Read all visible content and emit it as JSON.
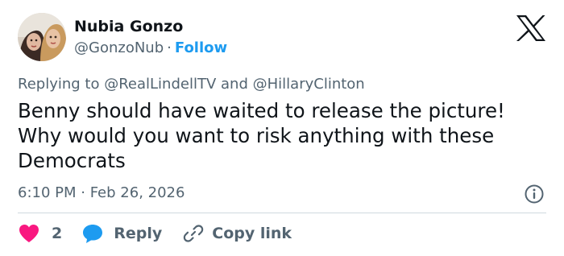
{
  "author": {
    "name": "Nubia Gonzo",
    "handle": "@GonzoNub",
    "separator": "·",
    "follow_label": "Follow",
    "avatar_icon": "profile-photo"
  },
  "brand": {
    "logo_icon": "x-logo"
  },
  "reply_context": {
    "prefix": "Replying to",
    "mention_1": "@RealLindellTV",
    "conjunction": "and",
    "mention_2": "@HillaryClinton"
  },
  "tweet": {
    "text": "Benny should have waited to release the picture! Why would you want to risk anything with these Democrats",
    "timestamp": "6:10 PM · Feb 26, 2026"
  },
  "actions": {
    "like_count": "2",
    "reply_label": "Reply",
    "copy_label": "Copy link",
    "like_icon": "heart-icon",
    "reply_icon": "speech-bubble-icon",
    "copy_icon": "link-icon",
    "info_icon": "info-icon"
  },
  "colors": {
    "text": "#0f1419",
    "secondary": "#536471",
    "accent": "#1d9bf0",
    "like": "#f91880",
    "divider": "#cfd9de"
  }
}
